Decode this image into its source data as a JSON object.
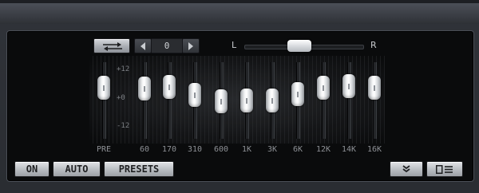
{
  "preset": {
    "number": "0"
  },
  "balance": {
    "left_label": "L",
    "right_label": "R",
    "value": 0.46
  },
  "scale": {
    "top": "+12",
    "mid": "+0",
    "bottom": "-12"
  },
  "bands": [
    {
      "label": "PRE",
      "level": 0.75
    },
    {
      "label": "60",
      "level": 0.72
    },
    {
      "label": "170",
      "level": 0.76
    },
    {
      "label": "310",
      "level": 0.6
    },
    {
      "label": "600",
      "level": 0.48
    },
    {
      "label": "1K",
      "level": 0.5
    },
    {
      "label": "3K",
      "level": 0.5
    },
    {
      "label": "6K",
      "level": 0.62
    },
    {
      "label": "12K",
      "level": 0.74
    },
    {
      "label": "14K",
      "level": 0.78
    },
    {
      "label": "16K",
      "level": 0.74
    }
  ],
  "buttons": {
    "on": "ON",
    "auto": "AUTO",
    "presets": "PRESETS"
  },
  "icons": {
    "link": "arrows-icon",
    "prev": "triangle-left-icon",
    "next": "triangle-right-icon",
    "collapse": "double-chevron-down-icon",
    "menu": "menu-list-icon"
  }
}
